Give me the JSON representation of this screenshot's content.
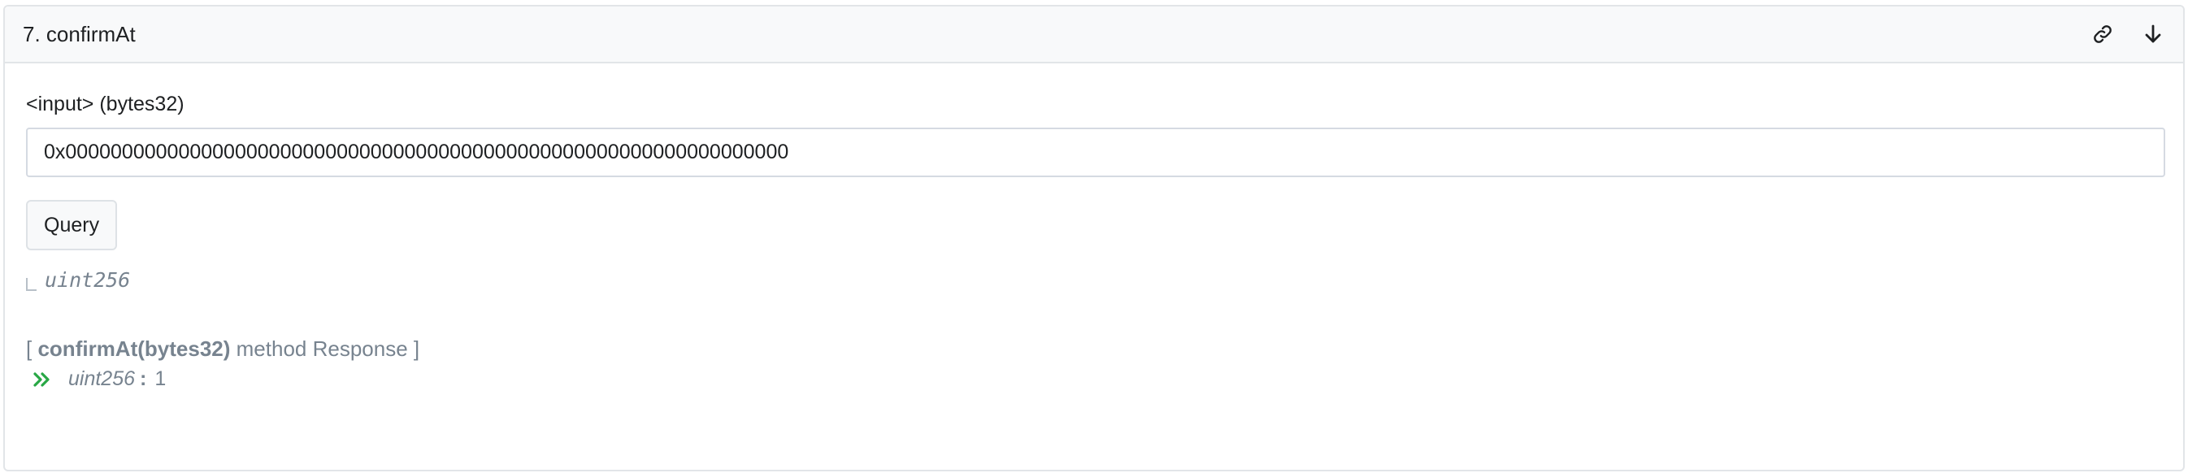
{
  "card": {
    "title": "7. confirmAt",
    "icons": {
      "link": "link-icon",
      "download": "arrow-down-icon"
    }
  },
  "input": {
    "label": "<input> (bytes32)",
    "value": "0x0000000000000000000000000000000000000000000000000000000000000000"
  },
  "query_button": {
    "label": "Query"
  },
  "return_type": "uint256",
  "response": {
    "open_bracket": "[",
    "method": "confirmAt(bytes32)",
    "suffix": "method Response ]",
    "chevron_icon": "double-chevron-right-icon",
    "type": "uint256",
    "colon": ":",
    "value": "1"
  },
  "colors": {
    "accent_green": "#28a745",
    "muted_text": "#77838f",
    "border": "#e2e5e8"
  }
}
